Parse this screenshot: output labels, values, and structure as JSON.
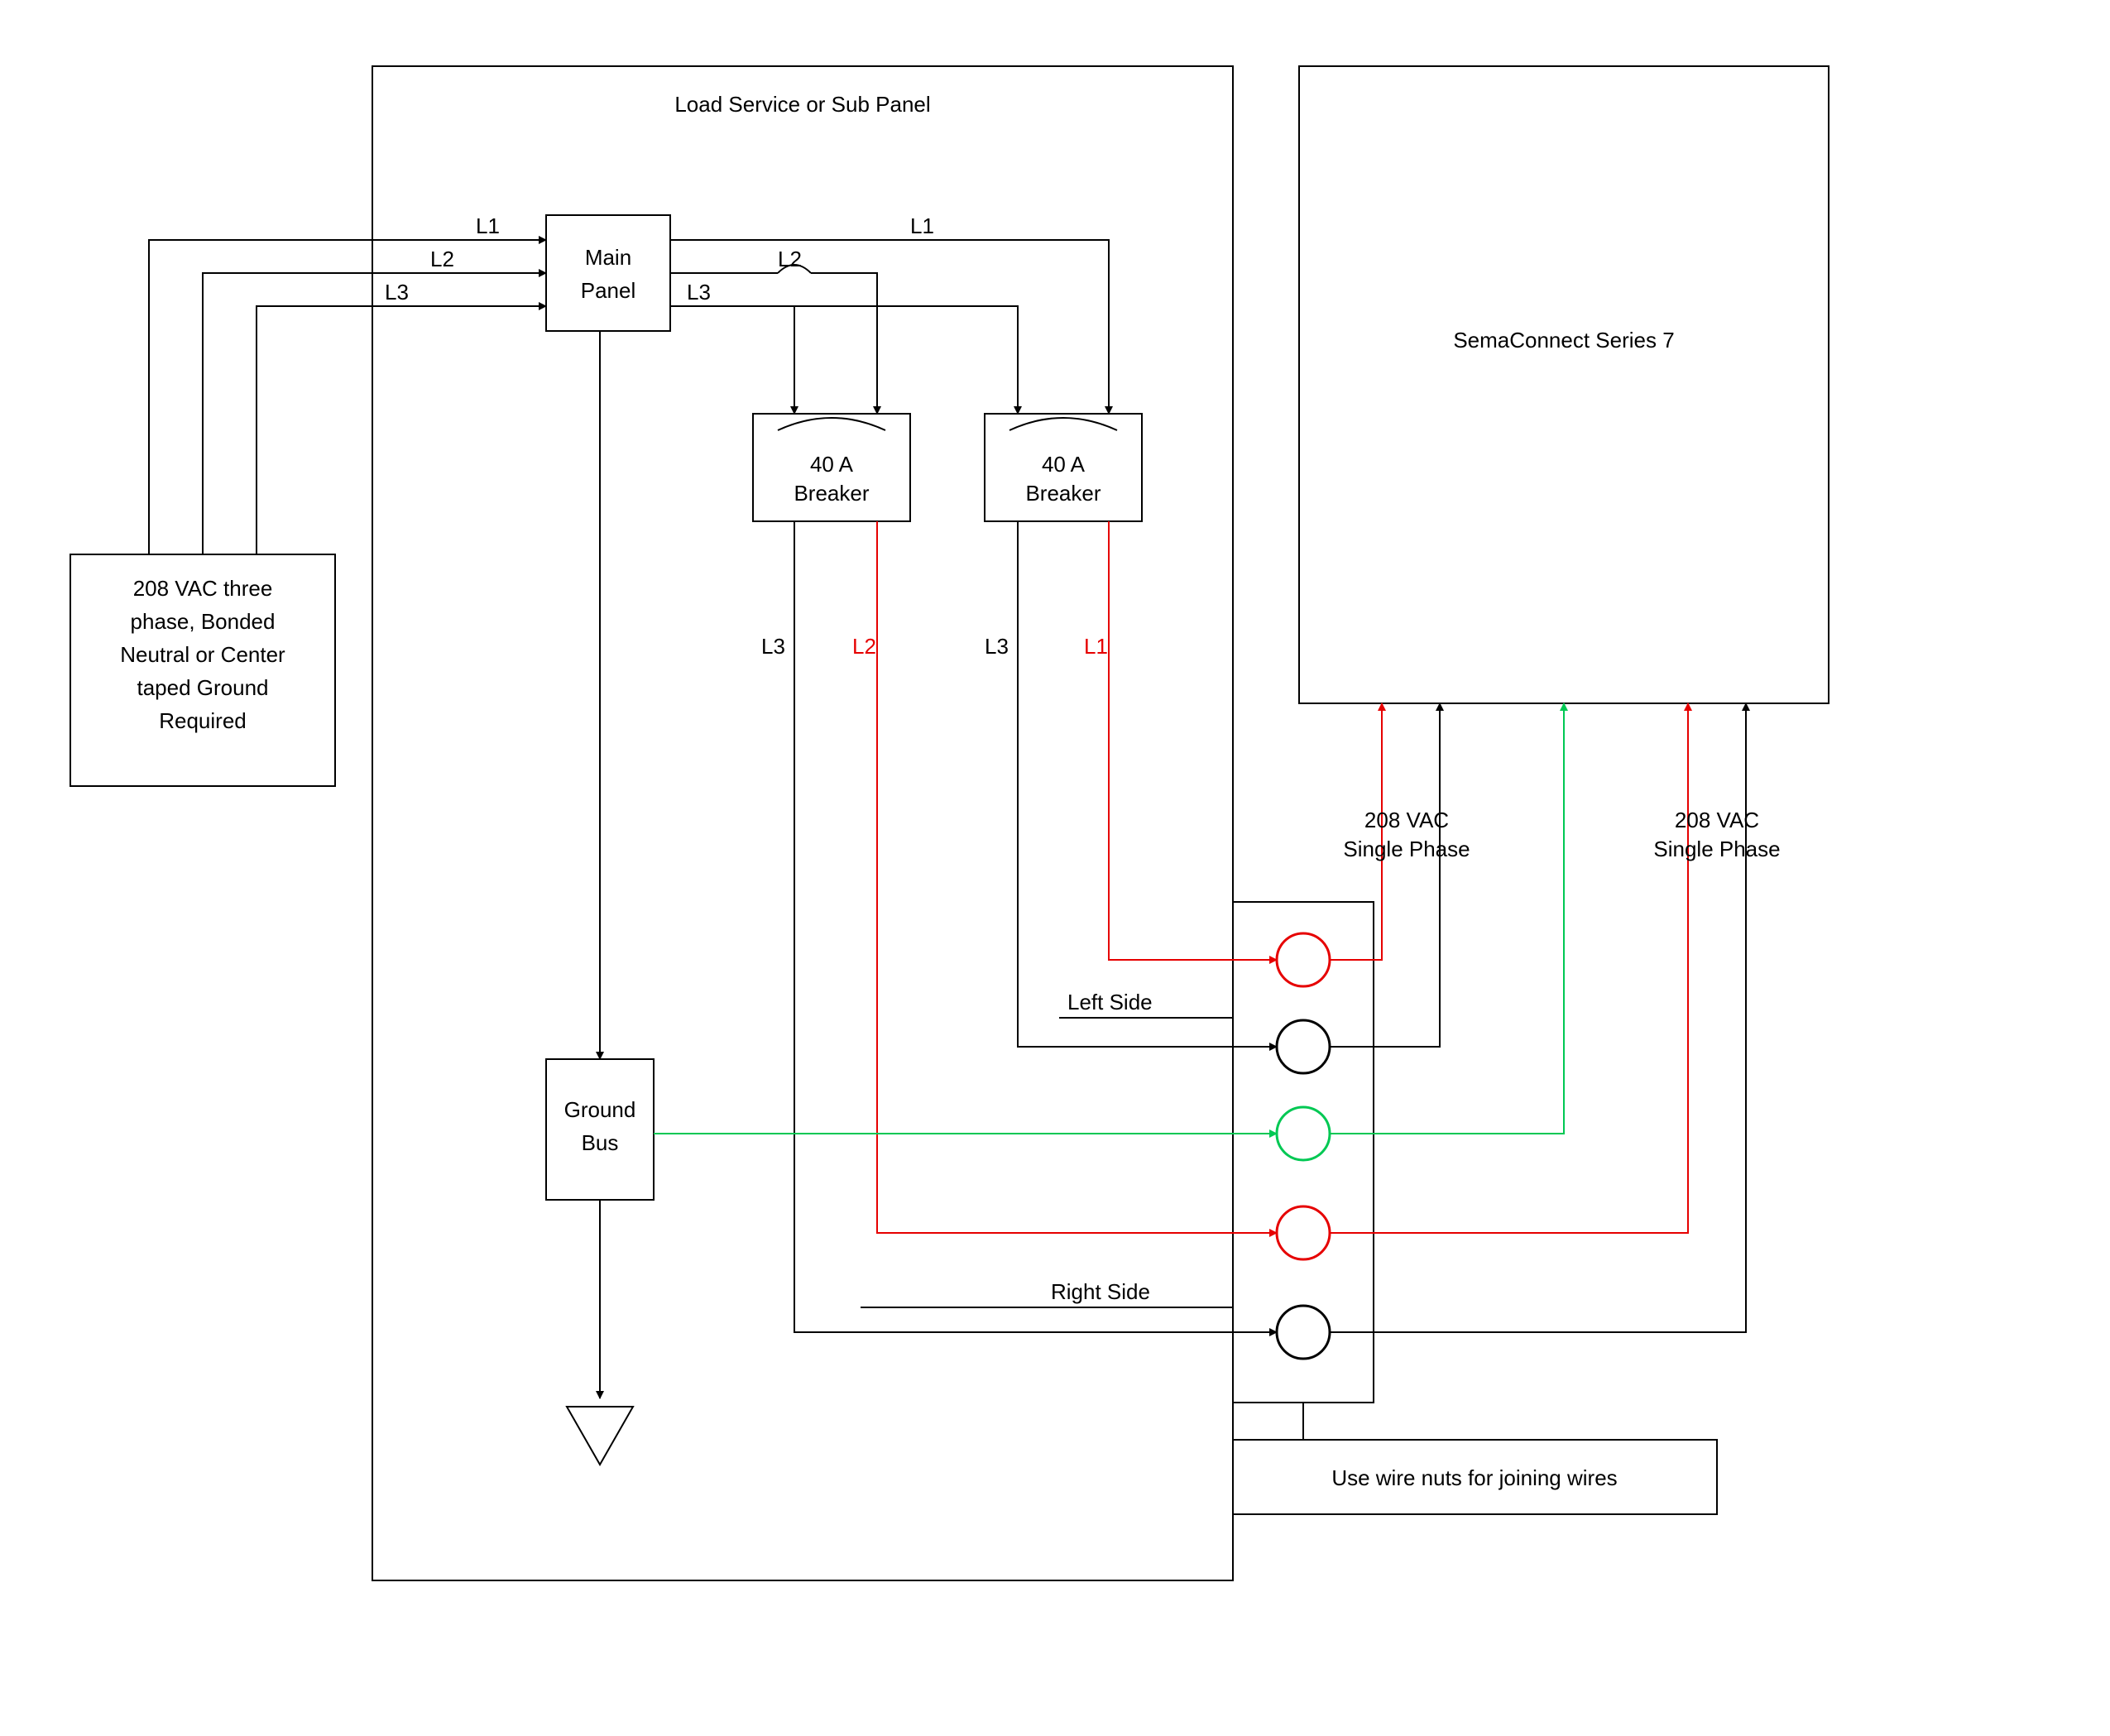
{
  "diagram": {
    "panel_title": "Load Service or Sub Panel",
    "source_box": {
      "line1": "208 VAC three",
      "line2": "phase, Bonded",
      "line3": "Neutral or Center",
      "line4": "taped Ground",
      "line5": "Required"
    },
    "main_panel": {
      "line1": "Main",
      "line2": "Panel"
    },
    "breaker1": {
      "line1": "40 A",
      "line2": "Breaker"
    },
    "breaker2": {
      "line1": "40 A",
      "line2": "Breaker"
    },
    "ground_bus": {
      "line1": "Ground",
      "line2": "Bus"
    },
    "phases": {
      "L1": "L1",
      "L2": "L2",
      "L3": "L3"
    },
    "breaker_out": {
      "b1_left": "L3",
      "b1_right": "L2",
      "b2_left": "L3",
      "b2_right": "L1"
    },
    "sides": {
      "left": "Left Side",
      "right": "Right Side"
    },
    "voltage": {
      "line1": "208 VAC",
      "line2": "Single Phase"
    },
    "device": "SemaConnect Series 7",
    "note": "Use wire nuts for joining wires"
  },
  "colors": {
    "red": "#e60000",
    "green": "#00c853",
    "black": "#000000"
  }
}
